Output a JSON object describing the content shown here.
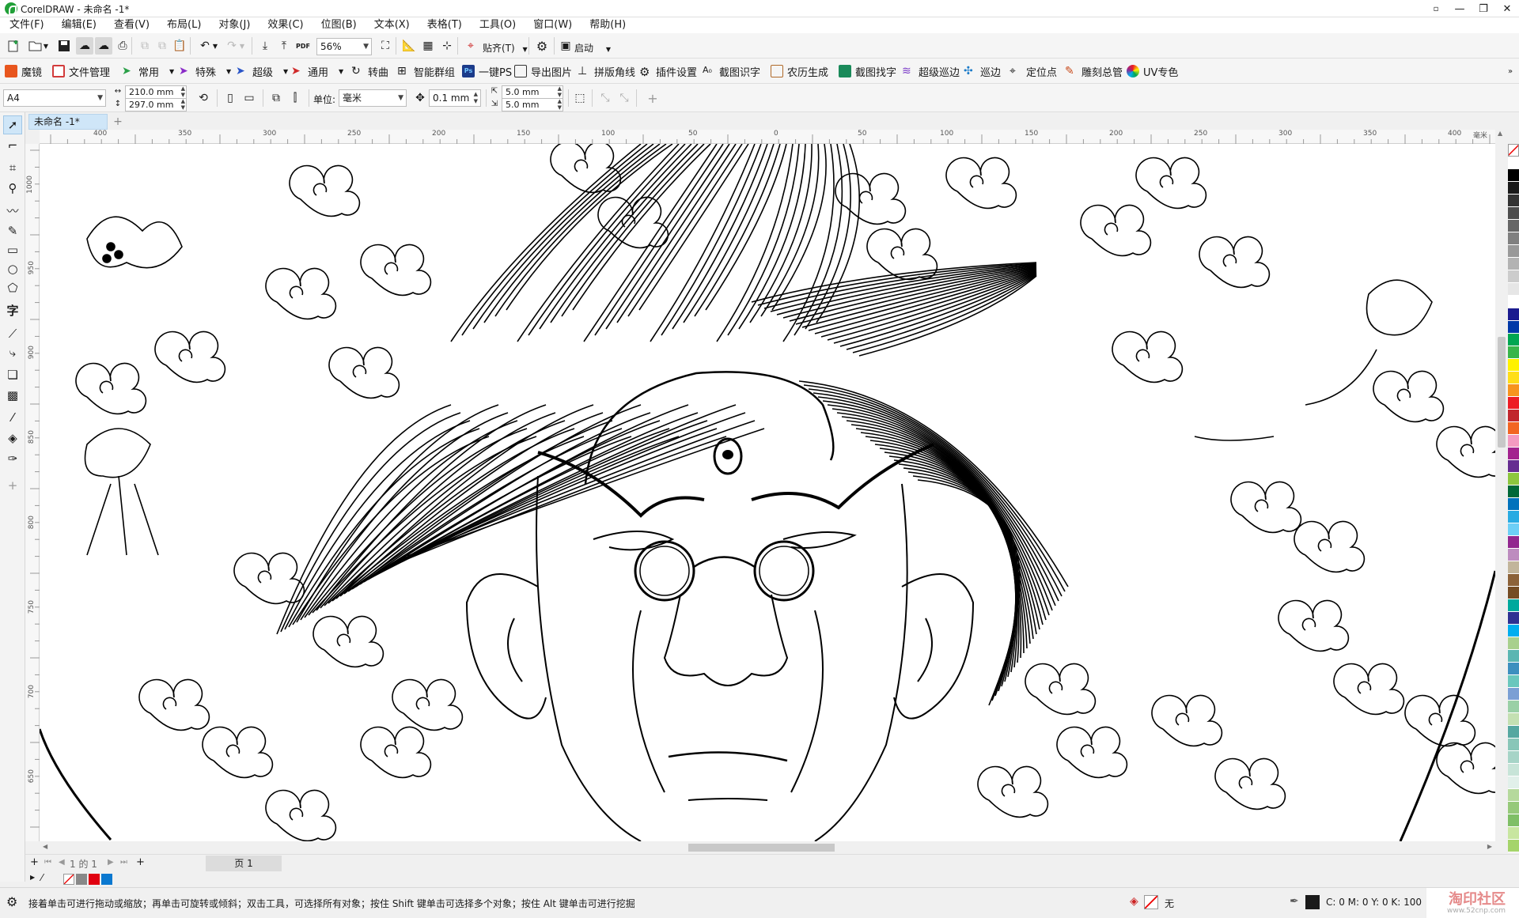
{
  "app": {
    "title": "CorelDRAW - 未命名 -1*"
  },
  "menu": [
    "文件(F)",
    "编辑(E)",
    "查看(V)",
    "布局(L)",
    "对象(J)",
    "效果(C)",
    "位图(B)",
    "文本(X)",
    "表格(T)",
    "工具(O)",
    "窗口(W)",
    "帮助(H)"
  ],
  "standard_toolbar": {
    "zoom": "56%",
    "snap_label": "贴齐(T)",
    "launch_label": "启动"
  },
  "plugins": [
    {
      "label": "魔镜",
      "color": "#e8561e"
    },
    {
      "label": "文件管理",
      "color": "#d23b3b"
    },
    {
      "label": "常用",
      "color": "#2aa048"
    },
    {
      "label": "特殊",
      "color": "#8a2bc8"
    },
    {
      "label": "超级",
      "color": "#2a55c8"
    },
    {
      "label": "通用",
      "color": "#d02a2a"
    },
    {
      "label": "转曲",
      "color": "#444444"
    },
    {
      "label": "智能群组",
      "color": "#444444"
    },
    {
      "label": "一键PS",
      "color": "#1c3b8a"
    },
    {
      "label": "导出图片",
      "color": "#444444"
    },
    {
      "label": "拼版角线",
      "color": "#444444"
    },
    {
      "label": "插件设置",
      "color": "#222222"
    },
    {
      "label": "截图识字",
      "color": "#444444"
    },
    {
      "label": "农历生成",
      "color": "#b06a2a"
    },
    {
      "label": "截图找字",
      "color": "#1a8a5a"
    },
    {
      "label": "超级巡边",
      "color": "#7a3ac8"
    },
    {
      "label": "巡边",
      "color": "#1a7ac8"
    },
    {
      "label": "定位点",
      "color": "#333333"
    },
    {
      "label": "雕刻总管",
      "color": "#c84a1a"
    },
    {
      "label": "UV专色",
      "color": "#c82a8a"
    }
  ],
  "property_bar": {
    "page_size": "A4",
    "width": "210.0 mm",
    "height": "297.0 mm",
    "units_label": "单位:",
    "units": "毫米",
    "nudge": "0.1 mm",
    "dup_x": "5.0 mm",
    "dup_y": "5.0 mm"
  },
  "document_tab": "未命名 -1*",
  "ruler": {
    "h_ticks": [
      "400",
      "350",
      "300",
      "250",
      "200",
      "150",
      "100",
      "50",
      "0",
      "50",
      "100",
      "150",
      "200",
      "250",
      "300",
      "350",
      "400"
    ],
    "h_unit": "毫米",
    "v_ticks": [
      "1000",
      "950",
      "900",
      "850",
      "800",
      "750",
      "700",
      "650"
    ]
  },
  "page_nav": {
    "counter": "1 的 1",
    "page_tab": "页 1"
  },
  "status": {
    "message": "接着单击可进行拖动或缩放；再单击可旋转或倾斜；双击工具，可选择所有对象；按住 Shift 键单击可选择多个对象；按住 Alt 键单击可进行挖掘",
    "fill": "无",
    "cmyk": "C: 0 M: 0 Y: 0 K: 100",
    "watermark": "淘印社区",
    "watermark_url": "www.52cnp.com"
  },
  "palette_colors": [
    "#ffffff",
    "#000000",
    "#1a1a1a",
    "#333333",
    "#4d4d4d",
    "#666666",
    "#808080",
    "#999999",
    "#b3b3b3",
    "#cccccc",
    "#e6e6e6",
    "#ffffff",
    "#1b1b8f",
    "#0038a8",
    "#00a651",
    "#39b54a",
    "#fff200",
    "#ffde17",
    "#f7941d",
    "#ed1c24",
    "#c1272d",
    "#f26522",
    "#f49ac1",
    "#a3238e",
    "#662d91",
    "#8dc63f",
    "#006838",
    "#0072bc",
    "#29abe2",
    "#6dcff6",
    "#92278f",
    "#bd8cbf",
    "#c2b59b",
    "#8c6239",
    "#754c24",
    "#00a99d",
    "#2e3192",
    "#00aeef",
    "#a8d08d",
    "#5bb6b2",
    "#3d8fbf",
    "#6ac7bd",
    "#7b9fd4",
    "#9ad0a6",
    "#c4e0b2",
    "#56a7a0",
    "#89c6b8",
    "#a6d4c7",
    "#c7e4d8",
    "#e1f0ea",
    "#b5d99c",
    "#96c97a",
    "#7fbf66",
    "#c8e6a0",
    "#a5d46b"
  ]
}
